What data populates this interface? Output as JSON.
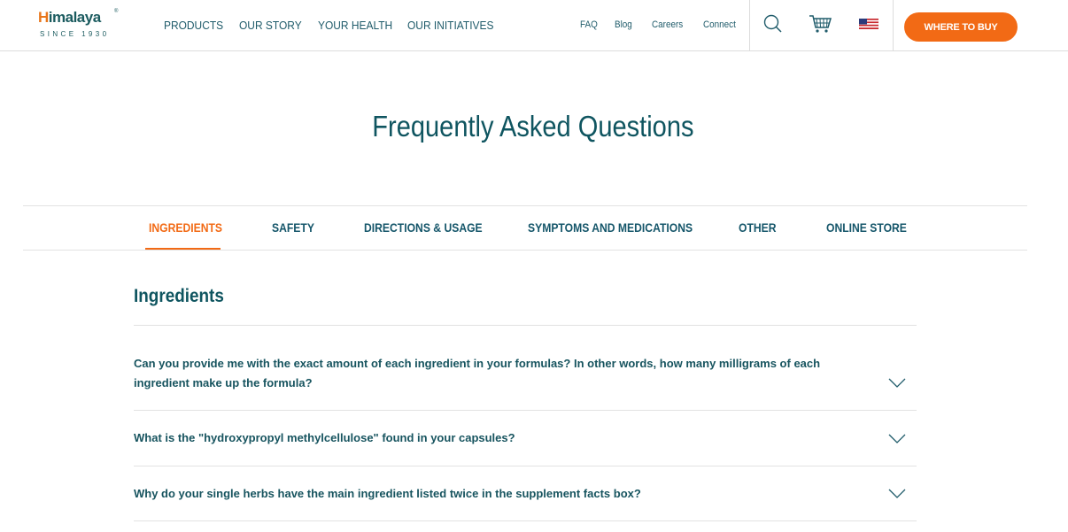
{
  "brand": {
    "name_prefix": "H",
    "name_rest": "imalaya",
    "reg": "®",
    "since": "SINCE 1930"
  },
  "main_nav": [
    "PRODUCTS",
    "OUR STORY",
    "YOUR HEALTH",
    "OUR INITIATIVES"
  ],
  "sub_nav": [
    "FAQ",
    "Blog",
    "Careers",
    "Connect"
  ],
  "icons": {
    "search": "search-icon",
    "cart": "cart-icon",
    "country": "us-flag-icon"
  },
  "cta": {
    "label": "WHERE TO BUY"
  },
  "colors": {
    "accent": "#f26a15",
    "primary_text": "#0f5560"
  },
  "page": {
    "title": "Frequently Asked Questions"
  },
  "tabs": [
    {
      "label": "INGREDIENTS",
      "active": true
    },
    {
      "label": "SAFETY",
      "active": false
    },
    {
      "label": "DIRECTIONS & USAGE",
      "active": false
    },
    {
      "label": "SYMPTOMS AND MEDICATIONS",
      "active": false
    },
    {
      "label": "OTHER",
      "active": false
    },
    {
      "label": "ONLINE STORE",
      "active": false
    }
  ],
  "section": {
    "title": "Ingredients",
    "questions": [
      {
        "line1": "Can you provide me with the exact amount of each ingredient in your formulas? In other words, how many milligrams of each",
        "line2": "ingredient make up the formula?"
      },
      {
        "line1": "What is the \"hydroxypropyl methylcellulose\" found in your capsules?",
        "line2": ""
      },
      {
        "line1": "Why do your single herbs have the main ingredient listed twice in the supplement facts box?",
        "line2": ""
      }
    ]
  }
}
